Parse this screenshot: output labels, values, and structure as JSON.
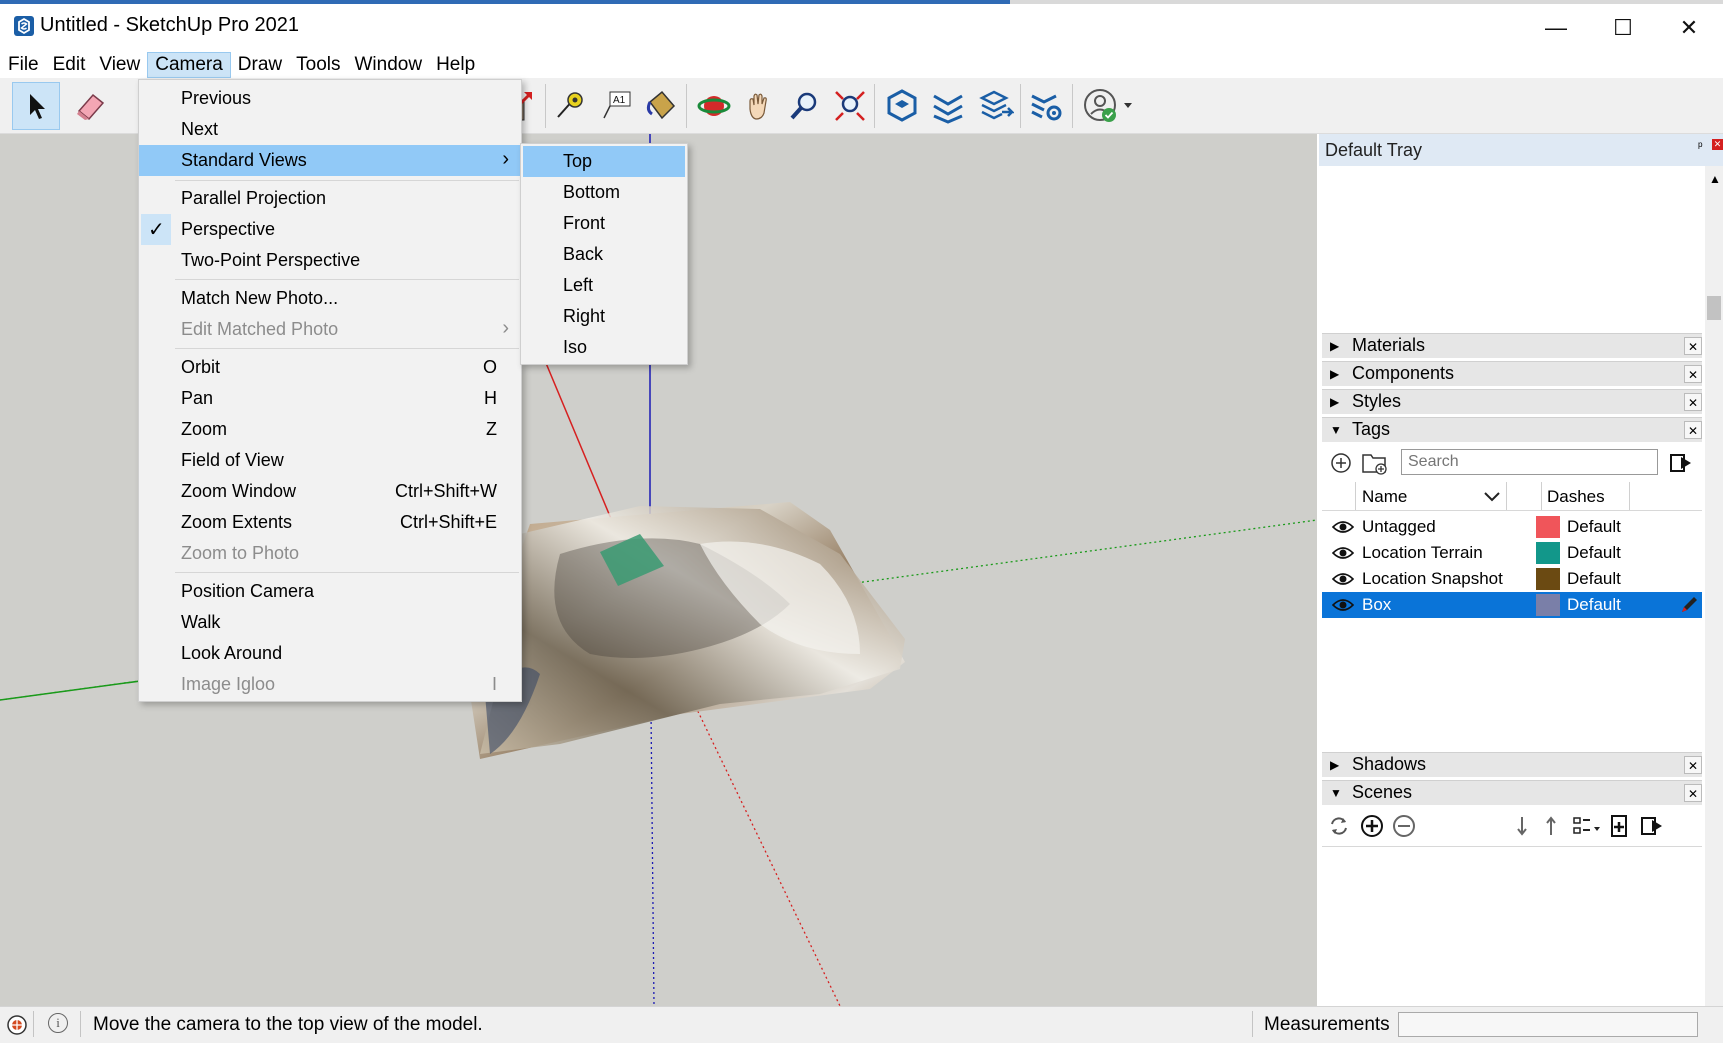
{
  "window": {
    "title": "Untitled - SketchUp Pro 2021",
    "minimize": "—",
    "maximize": "☐",
    "close": "✕"
  },
  "menubar": {
    "items": [
      {
        "label": "File"
      },
      {
        "label": "Edit"
      },
      {
        "label": "View"
      },
      {
        "label": "Camera",
        "active": true
      },
      {
        "label": "Draw"
      },
      {
        "label": "Tools"
      },
      {
        "label": "Window"
      },
      {
        "label": "Help"
      }
    ]
  },
  "camera_menu": {
    "previous": {
      "label": "Previous"
    },
    "next": {
      "label": "Next"
    },
    "standard_views": {
      "label": "Standard Views",
      "arrow": "›"
    },
    "parallel_projection": {
      "label": "Parallel Projection"
    },
    "perspective": {
      "label": "Perspective",
      "check": "✓"
    },
    "two_point_perspective": {
      "label": "Two-Point Perspective"
    },
    "match_new_photo": {
      "label": "Match New Photo..."
    },
    "edit_matched_photo": {
      "label": "Edit Matched Photo",
      "arrow": "›"
    },
    "orbit": {
      "label": "Orbit",
      "shortcut": "O"
    },
    "pan": {
      "label": "Pan",
      "shortcut": "H"
    },
    "zoom": {
      "label": "Zoom",
      "shortcut": "Z"
    },
    "field_of_view": {
      "label": "Field of View"
    },
    "zoom_window": {
      "label": "Zoom Window",
      "shortcut": "Ctrl+Shift+W"
    },
    "zoom_extents": {
      "label": "Zoom Extents",
      "shortcut": "Ctrl+Shift+E"
    },
    "zoom_to_photo": {
      "label": "Zoom to Photo"
    },
    "position_camera": {
      "label": "Position Camera"
    },
    "walk": {
      "label": "Walk"
    },
    "look_around": {
      "label": "Look Around"
    },
    "image_igloo": {
      "label": "Image Igloo",
      "shortcut": "I"
    }
  },
  "standard_views_menu": {
    "items": [
      "Top",
      "Bottom",
      "Front",
      "Back",
      "Left",
      "Right",
      "Iso"
    ],
    "highlighted": "Top"
  },
  "tray": {
    "title": "Default Tray",
    "pin": "ᵖ",
    "panels": {
      "materials": "Materials",
      "components": "Components",
      "styles": "Styles",
      "tags": "Tags",
      "shadows": "Shadows",
      "scenes": "Scenes"
    },
    "close_glyph": "✕",
    "collapsed_arrow": "▶",
    "expanded_arrow": "▼"
  },
  "tags": {
    "search_placeholder": "Search",
    "col_name": "Name",
    "col_dashes": "Dashes",
    "rows": [
      {
        "name": "Untagged",
        "color": "#f0555a",
        "dashes": "Default",
        "selected": false
      },
      {
        "name": "Location Terrain",
        "color": "#12978a",
        "dashes": "Default",
        "selected": false
      },
      {
        "name": "Location Snapshot",
        "color": "#6b4a12",
        "dashes": "Default",
        "selected": false
      },
      {
        "name": "Box",
        "color": "#7a7fa8",
        "dashes": "Default",
        "selected": true
      }
    ]
  },
  "statusbar": {
    "hint": "Move the camera to the top view of the model.",
    "measurements_label": "Measurements",
    "info_glyph": "i"
  },
  "colors": {
    "accent": "#0a74d8",
    "menu_highlight": "#91c9f7",
    "viewport_bg": "#cfcfcb",
    "axis_red": "#d62020",
    "axis_green": "#1a9a1a",
    "axis_blue": "#1a1ab4"
  }
}
